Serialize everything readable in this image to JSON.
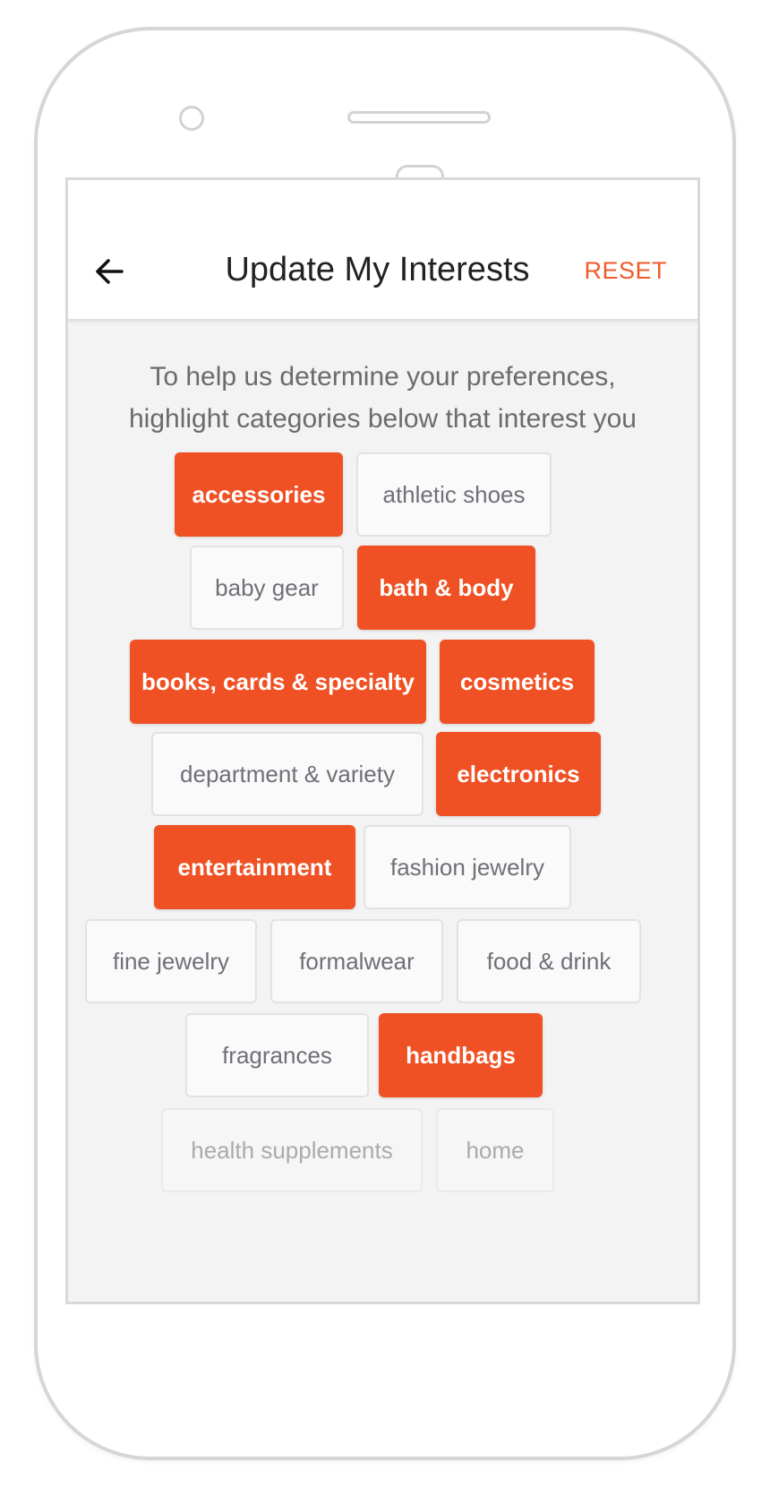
{
  "header": {
    "title": "Update My Interests",
    "reset_label": "RESET"
  },
  "intro": {
    "line1": "To help us determine your preferences,",
    "line2": "highlight categories below that interest you"
  },
  "categories": [
    {
      "label": "accessories",
      "selected": true
    },
    {
      "label": "athletic shoes",
      "selected": false
    },
    {
      "label": "baby gear",
      "selected": false
    },
    {
      "label": "bath & body",
      "selected": true
    },
    {
      "label": "books, cards & specialty",
      "selected": true
    },
    {
      "label": "cosmetics",
      "selected": true
    },
    {
      "label": "department & variety",
      "selected": false
    },
    {
      "label": "electronics",
      "selected": true
    },
    {
      "label": "entertainment",
      "selected": true
    },
    {
      "label": "fashion jewelry",
      "selected": false
    },
    {
      "label": "fine jewelry",
      "selected": false
    },
    {
      "label": "formalwear",
      "selected": false
    },
    {
      "label": "food & drink",
      "selected": false
    },
    {
      "label": "fragrances",
      "selected": false
    },
    {
      "label": "handbags",
      "selected": true
    },
    {
      "label": "health supplements",
      "selected": false
    },
    {
      "label": "home",
      "selected": false
    }
  ],
  "colors": {
    "accent": "#f05124",
    "chip_unselected_bg": "#fafafa",
    "screen_bg": "#f3f3f3"
  },
  "icons": {
    "back": "arrow-left-icon"
  }
}
